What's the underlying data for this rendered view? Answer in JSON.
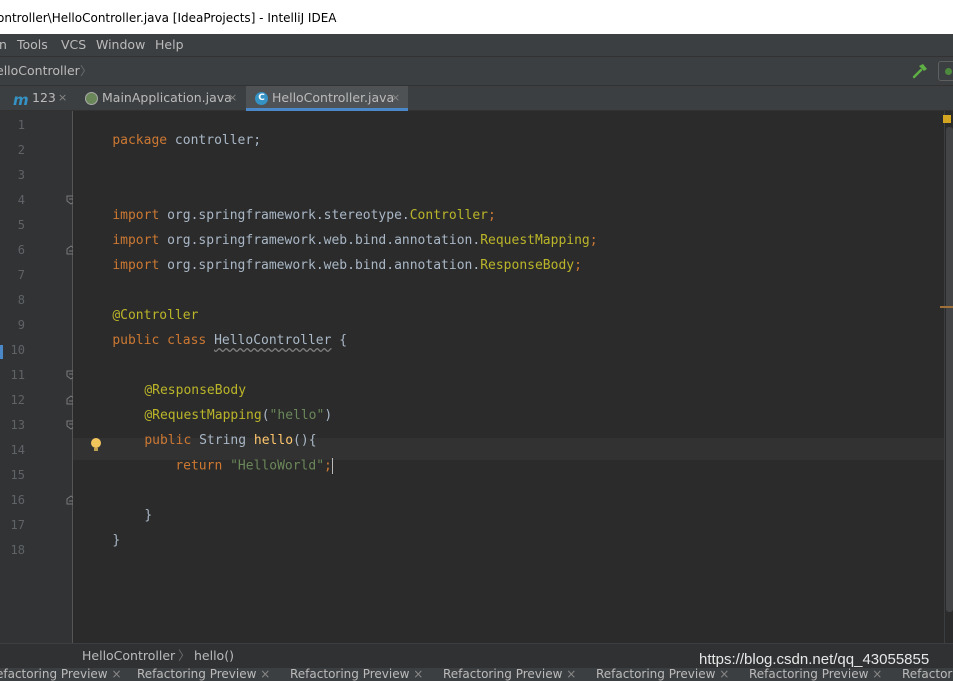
{
  "window": {
    "title": "ontroller\\HelloController.java [IdeaProjects] - IntelliJ IDEA"
  },
  "menu": [
    {
      "label": "n"
    },
    {
      "label": "Tools"
    },
    {
      "label": "VCS"
    },
    {
      "label": "Window"
    },
    {
      "label": "Help"
    }
  ],
  "navbar": {
    "crumb": "elloController",
    "chevron": "〉"
  },
  "tabs": [
    {
      "label": "123"
    },
    {
      "label": "MainApplication.java"
    },
    {
      "label": "HelloController.java"
    }
  ],
  "tab_close_glyph": "×",
  "line_numbers": [
    "1",
    "2",
    "3",
    "4",
    "5",
    "6",
    "7",
    "8",
    "9",
    "10",
    "11",
    "12",
    "13",
    "14",
    "15",
    "16",
    "17",
    "18"
  ],
  "code": {
    "l1_kw": "package",
    "l1_rest": " controller;",
    "l4_kw": "import",
    "l4_pkg": " org.springframework.stereotype.",
    "l4_cls": "Controller",
    "l4_semi": ";",
    "l5_kw": "import",
    "l5_pkg": " org.springframework.web.bind.annotation.",
    "l5_cls": "RequestMapping",
    "l5_semi": ";",
    "l6_kw": "import",
    "l6_pkg": " org.springframework.web.bind.annotation.",
    "l6_cls": "ResponseBody",
    "l6_semi": ";",
    "l8_ann": "@Controller",
    "l9_kw": "public class",
    "l9_name": "HelloController",
    "l9_brace": " {",
    "l11_ann": "@ResponseBody",
    "l12_ann": "@RequestMapping",
    "l12_open": "(",
    "l12_str": "\"hello\"",
    "l12_close": ")",
    "l13_kw": "public",
    "l13_type": " String ",
    "l13_fn": "hello",
    "l13_rest": "(){",
    "l14_kw": "return",
    "l14_str": "\"HelloWorld\"",
    "l14_semi": ";",
    "l16_brace": "}",
    "l17_brace": "}"
  },
  "editor_breadcrumb": {
    "class_name": "HelloController",
    "sep": "〉",
    "method": "hello()"
  },
  "watermark": "https://blog.csdn.net/qq_43055855",
  "bottom_tabs": [
    {
      "label": "efactoring Preview"
    },
    {
      "label": "Refactoring Preview"
    },
    {
      "label": "Refactoring Preview"
    },
    {
      "label": "Refactoring Preview"
    },
    {
      "label": "Refactoring Preview"
    },
    {
      "label": "Refactoring Preview"
    },
    {
      "label": "Refactor"
    }
  ],
  "colors": {
    "accent": "#4a88c7",
    "keyword": "#cc7832",
    "annotation": "#bbb529",
    "string": "#6a8759"
  }
}
